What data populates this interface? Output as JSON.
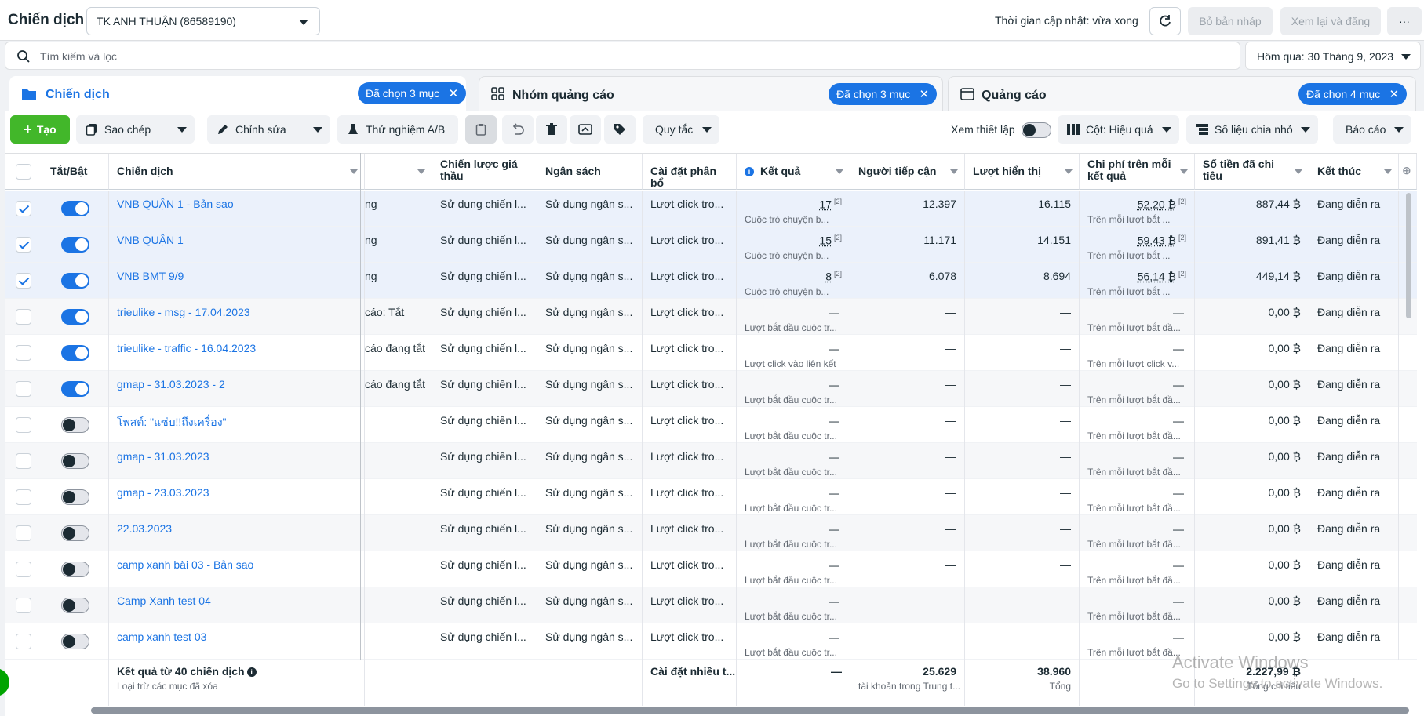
{
  "header": {
    "title": "Chiến dịch",
    "account": "TK ANH THUẬN (86589190)",
    "update_status": "Thời gian cập nhật: vừa xong",
    "discard_label": "Bỏ bản nháp",
    "review_label": "Xem lại và đăng",
    "more_label": "···"
  },
  "search": {
    "placeholder": "Tìm kiếm và lọc"
  },
  "date_range": "Hôm qua: 30 Tháng 9, 2023",
  "tabs": [
    {
      "label": "Chiến dịch",
      "chip": "Đã chọn 3 mục"
    },
    {
      "label": "Nhóm quảng cáo",
      "chip": "Đã chọn 3 mục"
    },
    {
      "label": "Quảng cáo",
      "chip": "Đã chọn 4 mục"
    }
  ],
  "toolbar": {
    "create": "Tạo",
    "duplicate": "Sao chép",
    "edit": "Chỉnh sửa",
    "ab_test": "Thử nghiệm A/B",
    "rules": "Quy tắc",
    "view_setup": "Xem thiết lập",
    "columns": "Cột: Hiệu quả",
    "breakdown": "Số liệu chia nhỏ",
    "reports": "Báo cáo"
  },
  "columns": {
    "toggle": "Tắt/Bật",
    "campaign": "Chiến dịch",
    "bid": "Chiến lược giá thầu",
    "budget": "Ngân sách",
    "attribution": "Cài đặt phân bổ",
    "results": "Kết quả",
    "reach": "Người tiếp cận",
    "impressions": "Lượt hiển thị",
    "cost_per_result": "Chi phí trên mỗi kết quả",
    "amount_spent": "Số tiền đã chi tiêu",
    "ends": "Kết thúc"
  },
  "rows": [
    {
      "name": "VNB QUẬN 1 - Bản sao",
      "delivery": "ng",
      "bid": "Sử dụng chiến l...",
      "budget": "Sử dụng ngân s...",
      "attribution": "Lượt click tro...",
      "result": "17",
      "result_sup": "[2]",
      "result_sub": "Cuộc trò chuyện b...",
      "reach": "12.397",
      "impressions": "16.115",
      "cpr": "52,20 ₿",
      "cpr_sup": "[2]",
      "cpr_sub": "Trên mỗi lượt bắt ...",
      "spent": "887,44 ₿",
      "ends": "Đang diễn ra",
      "on": true,
      "selected": true
    },
    {
      "name": "VNB QUẬN 1",
      "delivery": "ng",
      "bid": "Sử dụng chiến l...",
      "budget": "Sử dụng ngân s...",
      "attribution": "Lượt click tro...",
      "result": "15",
      "result_sup": "[2]",
      "result_sub": "Cuộc trò chuyện b...",
      "reach": "11.171",
      "impressions": "14.151",
      "cpr": "59,43 ₿",
      "cpr_sup": "[2]",
      "cpr_sub": "Trên mỗi lượt bắt ...",
      "spent": "891,41 ₿",
      "ends": "Đang diễn ra",
      "on": true,
      "selected": true
    },
    {
      "name": "VNB BMT 9/9",
      "delivery": "ng",
      "bid": "Sử dụng chiến l...",
      "budget": "Sử dụng ngân s...",
      "attribution": "Lượt click tro...",
      "result": "8",
      "result_sup": "[2]",
      "result_sub": "Cuộc trò chuyện b...",
      "reach": "6.078",
      "impressions": "8.694",
      "cpr": "56,14 ₿",
      "cpr_sup": "[2]",
      "cpr_sub": "Trên mỗi lượt bắt ...",
      "spent": "449,14 ₿",
      "ends": "Đang diễn ra",
      "on": true,
      "selected": true
    },
    {
      "name": "trieulike - msg - 17.04.2023",
      "delivery": "cáo: Tắt",
      "bid": "Sử dụng chiến l...",
      "budget": "Sử dụng ngân s...",
      "attribution": "Lượt click tro...",
      "result": "—",
      "result_sup": "",
      "result_sub": "Lượt bắt đầu cuộc tr...",
      "reach": "—",
      "impressions": "—",
      "cpr": "—",
      "cpr_sup": "",
      "cpr_sub": "Trên mỗi lượt bắt đầ...",
      "spent": "0,00 ₿",
      "ends": "Đang diễn ra",
      "on": true,
      "selected": false
    },
    {
      "name": "trieulike - traffic - 16.04.2023",
      "delivery": "cáo đang tắt",
      "bid": "Sử dụng chiến l...",
      "budget": "Sử dụng ngân s...",
      "attribution": "Lượt click tro...",
      "result": "—",
      "result_sup": "",
      "result_sub": "Lượt click vào liên kết",
      "reach": "—",
      "impressions": "—",
      "cpr": "—",
      "cpr_sup": "",
      "cpr_sub": "Trên mỗi lượt click v...",
      "spent": "0,00 ₿",
      "ends": "Đang diễn ra",
      "on": true,
      "selected": false
    },
    {
      "name": "gmap - 31.03.2023 - 2",
      "delivery": "cáo đang tắt",
      "bid": "Sử dụng chiến l...",
      "budget": "Sử dụng ngân s...",
      "attribution": "Lượt click tro...",
      "result": "—",
      "result_sup": "",
      "result_sub": "Lượt bắt đầu cuộc tr...",
      "reach": "—",
      "impressions": "—",
      "cpr": "—",
      "cpr_sup": "",
      "cpr_sub": "Trên mỗi lượt bắt đầ...",
      "spent": "0,00 ₿",
      "ends": "Đang diễn ra",
      "on": true,
      "selected": false
    },
    {
      "name": "โพสต์: \"แซ่บ!!ถึงเครื่อง\"",
      "delivery": "",
      "bid": "Sử dụng chiến l...",
      "budget": "Sử dụng ngân s...",
      "attribution": "Lượt click tro...",
      "result": "—",
      "result_sup": "",
      "result_sub": "Lượt bắt đầu cuộc tr...",
      "reach": "—",
      "impressions": "—",
      "cpr": "—",
      "cpr_sup": "",
      "cpr_sub": "Trên mỗi lượt bắt đầ...",
      "spent": "0,00 ₿",
      "ends": "Đang diễn ra",
      "on": false,
      "selected": false
    },
    {
      "name": "gmap - 31.03.2023",
      "delivery": "",
      "bid": "Sử dụng chiến l...",
      "budget": "Sử dụng ngân s...",
      "attribution": "Lượt click tro...",
      "result": "—",
      "result_sup": "",
      "result_sub": "Lượt bắt đầu cuộc tr...",
      "reach": "—",
      "impressions": "—",
      "cpr": "—",
      "cpr_sup": "",
      "cpr_sub": "Trên mỗi lượt bắt đầ...",
      "spent": "0,00 ₿",
      "ends": "Đang diễn ra",
      "on": false,
      "selected": false
    },
    {
      "name": "gmap - 23.03.2023",
      "delivery": "",
      "bid": "Sử dụng chiến l...",
      "budget": "Sử dụng ngân s...",
      "attribution": "Lượt click tro...",
      "result": "—",
      "result_sup": "",
      "result_sub": "Lượt bắt đầu cuộc tr...",
      "reach": "—",
      "impressions": "—",
      "cpr": "—",
      "cpr_sup": "",
      "cpr_sub": "Trên mỗi lượt bắt đầ...",
      "spent": "0,00 ₿",
      "ends": "Đang diễn ra",
      "on": false,
      "selected": false
    },
    {
      "name": "22.03.2023",
      "delivery": "",
      "bid": "Sử dụng chiến l...",
      "budget": "Sử dụng ngân s...",
      "attribution": "Lượt click tro...",
      "result": "—",
      "result_sup": "",
      "result_sub": "Lượt bắt đầu cuộc tr...",
      "reach": "—",
      "impressions": "—",
      "cpr": "—",
      "cpr_sup": "",
      "cpr_sub": "Trên mỗi lượt bắt đầ...",
      "spent": "0,00 ₿",
      "ends": "Đang diễn ra",
      "on": false,
      "selected": false
    },
    {
      "name": "camp xanh bài 03 - Bản sao",
      "delivery": "",
      "bid": "Sử dụng chiến l...",
      "budget": "Sử dụng ngân s...",
      "attribution": "Lượt click tro...",
      "result": "—",
      "result_sup": "",
      "result_sub": "Lượt bắt đầu cuộc tr...",
      "reach": "—",
      "impressions": "—",
      "cpr": "—",
      "cpr_sup": "",
      "cpr_sub": "Trên mỗi lượt bắt đầ...",
      "spent": "0,00 ₿",
      "ends": "Đang diễn ra",
      "on": false,
      "selected": false
    },
    {
      "name": "Camp Xanh test 04",
      "delivery": "",
      "bid": "Sử dụng chiến l...",
      "budget": "Sử dụng ngân s...",
      "attribution": "Lượt click tro...",
      "result": "—",
      "result_sup": "",
      "result_sub": "Lượt bắt đầu cuộc tr...",
      "reach": "—",
      "impressions": "—",
      "cpr": "—",
      "cpr_sup": "",
      "cpr_sub": "Trên mỗi lượt bắt đầ...",
      "spent": "0,00 ₿",
      "ends": "Đang diễn ra",
      "on": false,
      "selected": false
    },
    {
      "name": "camp xanh test 03",
      "delivery": "",
      "bid": "Sử dụng chiến l...",
      "budget": "Sử dụng ngân s...",
      "attribution": "Lượt click tro...",
      "result": "—",
      "result_sup": "",
      "result_sub": "Lượt bắt đầu cuộc tr...",
      "reach": "—",
      "impressions": "—",
      "cpr": "—",
      "cpr_sup": "",
      "cpr_sub": "Trên mỗi lượt bắt đầ...",
      "spent": "0,00 ₿",
      "ends": "Đang diễn ra",
      "on": false,
      "selected": false
    }
  ],
  "totals": {
    "label": "Kết quả từ 40 chiến dịch",
    "sub": "Loại trừ các mục đã xóa",
    "attribution": "Cài đặt nhiều t...",
    "result": "—",
    "reach": "25.629",
    "reach_sub": "tài khoản trong Trung t...",
    "impressions": "38.960",
    "impressions_sub": "Tổng",
    "spent": "2.227,99 ₿",
    "spent_sub": "Tổng chi tiêu"
  },
  "watermark": {
    "line1": "Activate Windows",
    "line2": "Go to Settings to activate Windows."
  },
  "colors": {
    "accent": "#1b74e4",
    "create": "#42b72a",
    "selected_row": "#ebf1fb"
  }
}
